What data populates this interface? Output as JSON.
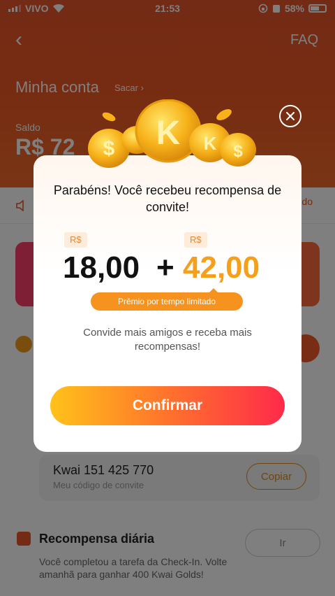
{
  "status_bar": {
    "carrier": "VIVO",
    "time": "21:53",
    "battery": "58%"
  },
  "header": {
    "faq_label": "FAQ",
    "title": "Minha conta",
    "withdraw_link": "Sacar ›",
    "balance_label": "Saldo",
    "balance_value": "R$ 72"
  },
  "notice": {
    "link": "do"
  },
  "invite_code": {
    "code": "Kwai 151 425 770",
    "sublabel": "Meu código de convite",
    "copy_label": "Copiar"
  },
  "daily_reward": {
    "title": "Recompensa diária",
    "description": "Você completou a tarefa da Check-In. Volte amanhã para ganhar 400 Kwai Golds!",
    "button_label": "Ir"
  },
  "modal": {
    "title": "Parabéns! Você recebeu recompensa de convite!",
    "currency_a": "R$",
    "amount_a": "18,00",
    "plus": "+",
    "currency_b": "R$",
    "amount_b": "42,00",
    "limited_label": "Prêmio por tempo limitado",
    "message": "Convide mais amigos e receba mais recompensas!",
    "confirm_label": "Confirmar"
  },
  "colors": {
    "header_bg": "#e8562a",
    "accent_orange": "#f5a01c",
    "confirm_gradient_start": "#ffc21a",
    "confirm_gradient_end": "#ff2a4a"
  }
}
